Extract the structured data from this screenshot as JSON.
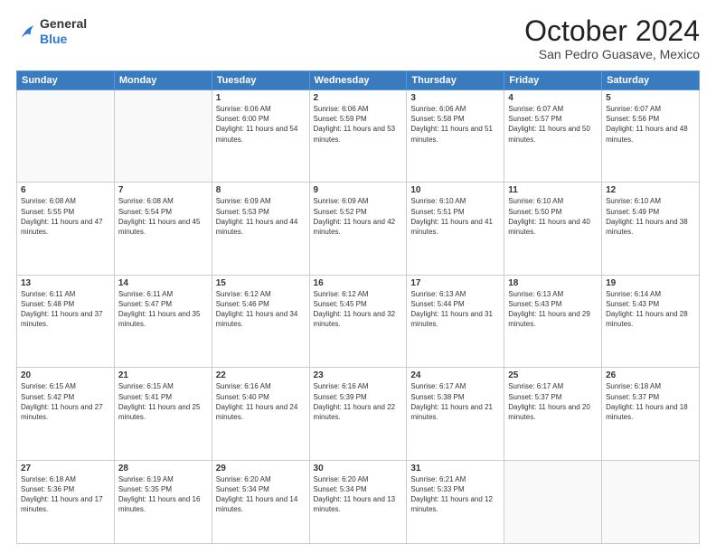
{
  "header": {
    "logo_general": "General",
    "logo_blue": "Blue",
    "month_title": "October 2024",
    "location": "San Pedro Guasave, Mexico"
  },
  "weekdays": [
    "Sunday",
    "Monday",
    "Tuesday",
    "Wednesday",
    "Thursday",
    "Friday",
    "Saturday"
  ],
  "weeks": [
    [
      {
        "day": "",
        "sunrise": "",
        "sunset": "",
        "daylight": ""
      },
      {
        "day": "",
        "sunrise": "",
        "sunset": "",
        "daylight": ""
      },
      {
        "day": "1",
        "sunrise": "Sunrise: 6:06 AM",
        "sunset": "Sunset: 6:00 PM",
        "daylight": "Daylight: 11 hours and 54 minutes."
      },
      {
        "day": "2",
        "sunrise": "Sunrise: 6:06 AM",
        "sunset": "Sunset: 5:59 PM",
        "daylight": "Daylight: 11 hours and 53 minutes."
      },
      {
        "day": "3",
        "sunrise": "Sunrise: 6:06 AM",
        "sunset": "Sunset: 5:58 PM",
        "daylight": "Daylight: 11 hours and 51 minutes."
      },
      {
        "day": "4",
        "sunrise": "Sunrise: 6:07 AM",
        "sunset": "Sunset: 5:57 PM",
        "daylight": "Daylight: 11 hours and 50 minutes."
      },
      {
        "day": "5",
        "sunrise": "Sunrise: 6:07 AM",
        "sunset": "Sunset: 5:56 PM",
        "daylight": "Daylight: 11 hours and 48 minutes."
      }
    ],
    [
      {
        "day": "6",
        "sunrise": "Sunrise: 6:08 AM",
        "sunset": "Sunset: 5:55 PM",
        "daylight": "Daylight: 11 hours and 47 minutes."
      },
      {
        "day": "7",
        "sunrise": "Sunrise: 6:08 AM",
        "sunset": "Sunset: 5:54 PM",
        "daylight": "Daylight: 11 hours and 45 minutes."
      },
      {
        "day": "8",
        "sunrise": "Sunrise: 6:09 AM",
        "sunset": "Sunset: 5:53 PM",
        "daylight": "Daylight: 11 hours and 44 minutes."
      },
      {
        "day": "9",
        "sunrise": "Sunrise: 6:09 AM",
        "sunset": "Sunset: 5:52 PM",
        "daylight": "Daylight: 11 hours and 42 minutes."
      },
      {
        "day": "10",
        "sunrise": "Sunrise: 6:10 AM",
        "sunset": "Sunset: 5:51 PM",
        "daylight": "Daylight: 11 hours and 41 minutes."
      },
      {
        "day": "11",
        "sunrise": "Sunrise: 6:10 AM",
        "sunset": "Sunset: 5:50 PM",
        "daylight": "Daylight: 11 hours and 40 minutes."
      },
      {
        "day": "12",
        "sunrise": "Sunrise: 6:10 AM",
        "sunset": "Sunset: 5:49 PM",
        "daylight": "Daylight: 11 hours and 38 minutes."
      }
    ],
    [
      {
        "day": "13",
        "sunrise": "Sunrise: 6:11 AM",
        "sunset": "Sunset: 5:48 PM",
        "daylight": "Daylight: 11 hours and 37 minutes."
      },
      {
        "day": "14",
        "sunrise": "Sunrise: 6:11 AM",
        "sunset": "Sunset: 5:47 PM",
        "daylight": "Daylight: 11 hours and 35 minutes."
      },
      {
        "day": "15",
        "sunrise": "Sunrise: 6:12 AM",
        "sunset": "Sunset: 5:46 PM",
        "daylight": "Daylight: 11 hours and 34 minutes."
      },
      {
        "day": "16",
        "sunrise": "Sunrise: 6:12 AM",
        "sunset": "Sunset: 5:45 PM",
        "daylight": "Daylight: 11 hours and 32 minutes."
      },
      {
        "day": "17",
        "sunrise": "Sunrise: 6:13 AM",
        "sunset": "Sunset: 5:44 PM",
        "daylight": "Daylight: 11 hours and 31 minutes."
      },
      {
        "day": "18",
        "sunrise": "Sunrise: 6:13 AM",
        "sunset": "Sunset: 5:43 PM",
        "daylight": "Daylight: 11 hours and 29 minutes."
      },
      {
        "day": "19",
        "sunrise": "Sunrise: 6:14 AM",
        "sunset": "Sunset: 5:43 PM",
        "daylight": "Daylight: 11 hours and 28 minutes."
      }
    ],
    [
      {
        "day": "20",
        "sunrise": "Sunrise: 6:15 AM",
        "sunset": "Sunset: 5:42 PM",
        "daylight": "Daylight: 11 hours and 27 minutes."
      },
      {
        "day": "21",
        "sunrise": "Sunrise: 6:15 AM",
        "sunset": "Sunset: 5:41 PM",
        "daylight": "Daylight: 11 hours and 25 minutes."
      },
      {
        "day": "22",
        "sunrise": "Sunrise: 6:16 AM",
        "sunset": "Sunset: 5:40 PM",
        "daylight": "Daylight: 11 hours and 24 minutes."
      },
      {
        "day": "23",
        "sunrise": "Sunrise: 6:16 AM",
        "sunset": "Sunset: 5:39 PM",
        "daylight": "Daylight: 11 hours and 22 minutes."
      },
      {
        "day": "24",
        "sunrise": "Sunrise: 6:17 AM",
        "sunset": "Sunset: 5:38 PM",
        "daylight": "Daylight: 11 hours and 21 minutes."
      },
      {
        "day": "25",
        "sunrise": "Sunrise: 6:17 AM",
        "sunset": "Sunset: 5:37 PM",
        "daylight": "Daylight: 11 hours and 20 minutes."
      },
      {
        "day": "26",
        "sunrise": "Sunrise: 6:18 AM",
        "sunset": "Sunset: 5:37 PM",
        "daylight": "Daylight: 11 hours and 18 minutes."
      }
    ],
    [
      {
        "day": "27",
        "sunrise": "Sunrise: 6:18 AM",
        "sunset": "Sunset: 5:36 PM",
        "daylight": "Daylight: 11 hours and 17 minutes."
      },
      {
        "day": "28",
        "sunrise": "Sunrise: 6:19 AM",
        "sunset": "Sunset: 5:35 PM",
        "daylight": "Daylight: 11 hours and 16 minutes."
      },
      {
        "day": "29",
        "sunrise": "Sunrise: 6:20 AM",
        "sunset": "Sunset: 5:34 PM",
        "daylight": "Daylight: 11 hours and 14 minutes."
      },
      {
        "day": "30",
        "sunrise": "Sunrise: 6:20 AM",
        "sunset": "Sunset: 5:34 PM",
        "daylight": "Daylight: 11 hours and 13 minutes."
      },
      {
        "day": "31",
        "sunrise": "Sunrise: 6:21 AM",
        "sunset": "Sunset: 5:33 PM",
        "daylight": "Daylight: 11 hours and 12 minutes."
      },
      {
        "day": "",
        "sunrise": "",
        "sunset": "",
        "daylight": ""
      },
      {
        "day": "",
        "sunrise": "",
        "sunset": "",
        "daylight": ""
      }
    ]
  ]
}
